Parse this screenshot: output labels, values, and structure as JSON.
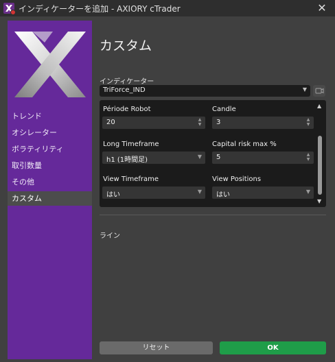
{
  "window": {
    "title": "インディケーターを追加 - AXIORY cTrader",
    "close_glyph": "✕"
  },
  "sidebar": {
    "items": [
      {
        "label": "トレンド"
      },
      {
        "label": "オシレーター"
      },
      {
        "label": "ボラティリティ"
      },
      {
        "label": "取引数量"
      },
      {
        "label": "その他"
      },
      {
        "label": "カスタム"
      }
    ],
    "selected": "カスタム",
    "color": "#65299a"
  },
  "main": {
    "title": "カスタム",
    "indicator_label": "インディケーター",
    "indicator_value": "TriForce_IND",
    "parameters": {
      "periode_robot": {
        "label": "Période Robot",
        "value": "20"
      },
      "candle": {
        "label": "Candle",
        "value": "3"
      },
      "long_timeframe": {
        "label": "Long Timeframe",
        "value": "h1 (1時間足)"
      },
      "capital_risk": {
        "label": "Capital risk max %",
        "value": "5"
      },
      "view_timeframe": {
        "label": "View Timeframe",
        "value": "はい"
      },
      "view_positions": {
        "label": "View Positions",
        "value": "はい"
      }
    },
    "lines_label": "ライン"
  },
  "buttons": {
    "reset": "リセット",
    "ok": "OK",
    "ok_color": "#1f9d49"
  },
  "icons": {
    "app": "app-icon",
    "close": "close-icon",
    "dropdown": "chevron-down-icon",
    "spinner": "spinner-icon",
    "camera": "camera-icon"
  }
}
